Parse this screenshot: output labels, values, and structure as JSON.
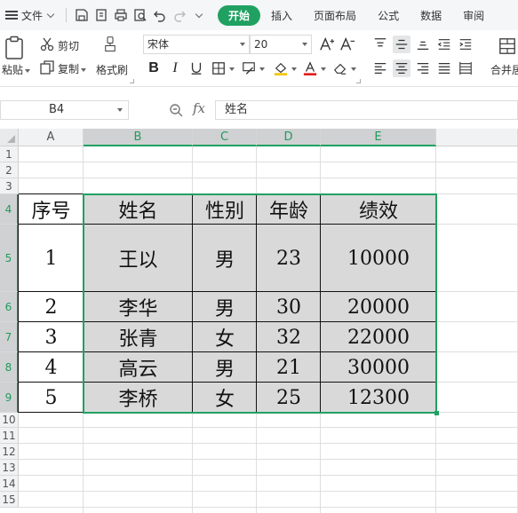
{
  "menubar": {
    "file_label": "文件",
    "tabs": [
      "开始",
      "插入",
      "页面布局",
      "公式",
      "数据",
      "审阅"
    ],
    "active_tab": "开始"
  },
  "ribbon": {
    "paste": "粘贴",
    "cut": "剪切",
    "copy": "复制",
    "format_painter": "格式刷",
    "font_name": "宋体",
    "font_size": "20",
    "merge_center": "合并居"
  },
  "formula_bar": {
    "name_box": "B4",
    "fx": "fx",
    "content": "姓名"
  },
  "sheet": {
    "columns": [
      "A",
      "B",
      "C",
      "D",
      "E"
    ],
    "rows": [
      "1",
      "2",
      "3",
      "4",
      "5",
      "6",
      "7",
      "8",
      "9",
      "10",
      "11",
      "12",
      "13",
      "14",
      "15"
    ],
    "table": {
      "headers": [
        "序号",
        "姓名",
        "性别",
        "年龄",
        "绩效"
      ],
      "records": [
        [
          "1",
          "王以",
          "男",
          "23",
          "10000"
        ],
        [
          "2",
          "李华",
          "男",
          "30",
          "20000"
        ],
        [
          "3",
          "张青",
          "女",
          "32",
          "22000"
        ],
        [
          "4",
          "高云",
          "男",
          "21",
          "30000"
        ],
        [
          "5",
          "李桥",
          "女",
          "25",
          "12300"
        ]
      ]
    }
  },
  "colors": {
    "accent": "#20a162",
    "selection_fill": "#d9d9d9"
  }
}
